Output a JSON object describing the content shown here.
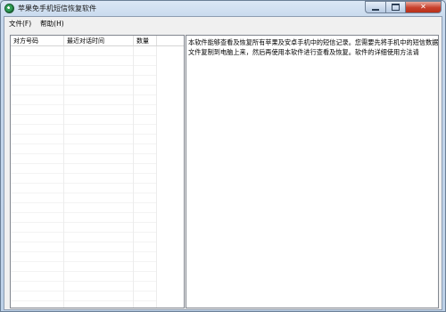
{
  "window": {
    "title": "苹果免手机短信恢复软件"
  },
  "menu": {
    "items": [
      "文件(F)",
      "帮助(H)"
    ]
  },
  "list": {
    "columns": [
      "对方号码",
      "最近对话时间",
      "数量"
    ],
    "rows": []
  },
  "description": {
    "text": "本软件能够查看及恢复所有苹果及安卓手机中的短信记录。您需要先将手机中的短信数据库文件复制到电脑上来，然后再使用本软件进行查看及恢复。软件的详细使用方法请"
  }
}
